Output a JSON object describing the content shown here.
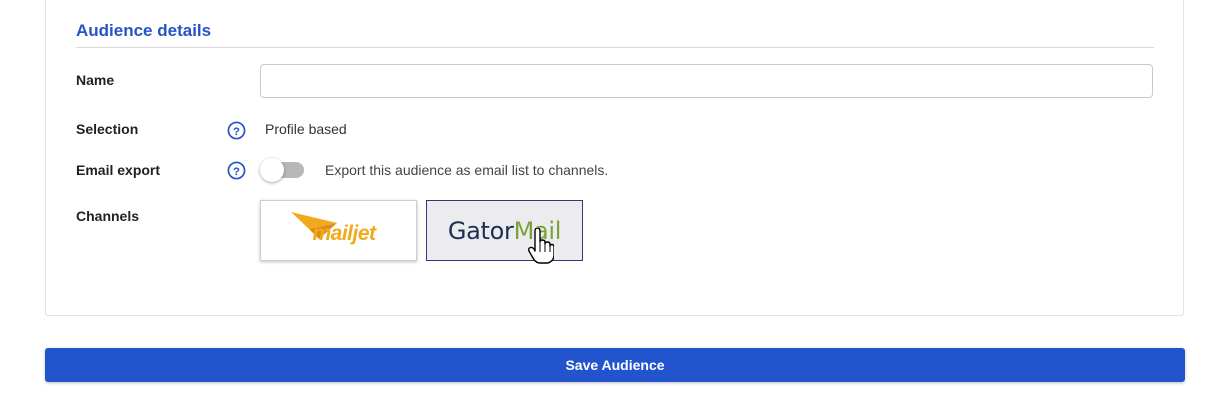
{
  "section": {
    "title": "Audience details"
  },
  "fields": {
    "name": {
      "label": "Name",
      "value": "",
      "placeholder": ""
    },
    "selection": {
      "label": "Selection",
      "value": "Profile based"
    },
    "email_export": {
      "label": "Email export",
      "enabled": false,
      "description": "Export this audience as email list to channels."
    },
    "channels": {
      "label": "Channels",
      "items": [
        {
          "name": "mailjet",
          "logo_text": "mailjet",
          "selected": false
        },
        {
          "name": "GatorMail",
          "logo_text_part1": "Gator",
          "logo_text_part2": "Mail",
          "selected": true
        }
      ]
    }
  },
  "actions": {
    "save_label": "Save Audience"
  },
  "colors": {
    "accent": "#2654c7",
    "button": "#2254ce",
    "mailjet": "#f2a91e",
    "gator_dark": "#1f2f52",
    "gator_green": "#7aa23a"
  },
  "icons": {
    "help": "question-circle-icon",
    "cursor": "hand-pointer-icon"
  }
}
